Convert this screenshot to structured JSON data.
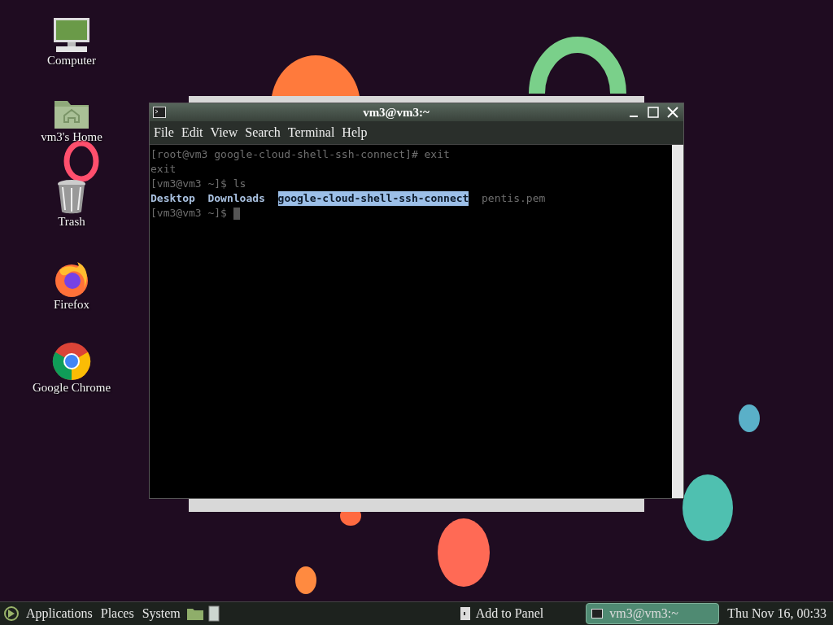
{
  "desktop_icons": [
    {
      "kind": "computer",
      "label": "Computer"
    },
    {
      "kind": "home",
      "label": "vm3's Home"
    },
    {
      "kind": "trash",
      "label": "Trash"
    },
    {
      "kind": "firefox",
      "label": "Firefox"
    },
    {
      "kind": "chrome",
      "label": "Google Chrome"
    }
  ],
  "window": {
    "title": "vm3@vm3:~",
    "menu": [
      "File",
      "Edit",
      "View",
      "Search",
      "Terminal",
      "Help"
    ],
    "lines": [
      {
        "kind": "text",
        "text": "[root@vm3 google-cloud-shell-ssh-connect]# exit"
      },
      {
        "kind": "text",
        "text": "exit"
      },
      {
        "kind": "text",
        "text": "[vm3@vm3 ~]$ ls"
      },
      {
        "kind": "listing",
        "items": [
          {
            "kind": "dir",
            "text": "Desktop",
            "selected": false
          },
          {
            "kind": "dir",
            "text": "Downloads",
            "selected": false
          },
          {
            "kind": "dir",
            "text": "google-cloud-shell-ssh-connect",
            "selected": true
          },
          {
            "kind": "file",
            "text": "pentis.pem",
            "selected": false
          }
        ]
      },
      {
        "kind": "prompt",
        "text": "[vm3@vm3 ~]$"
      }
    ]
  },
  "taskbar": {
    "menus": [
      "Applications",
      "Places",
      "System"
    ],
    "launcher": "Add to Panel",
    "tasks": [
      {
        "label": "vm3@vm3:~",
        "selected": true
      }
    ],
    "clock": "Thu Nov 16, 00:33"
  }
}
